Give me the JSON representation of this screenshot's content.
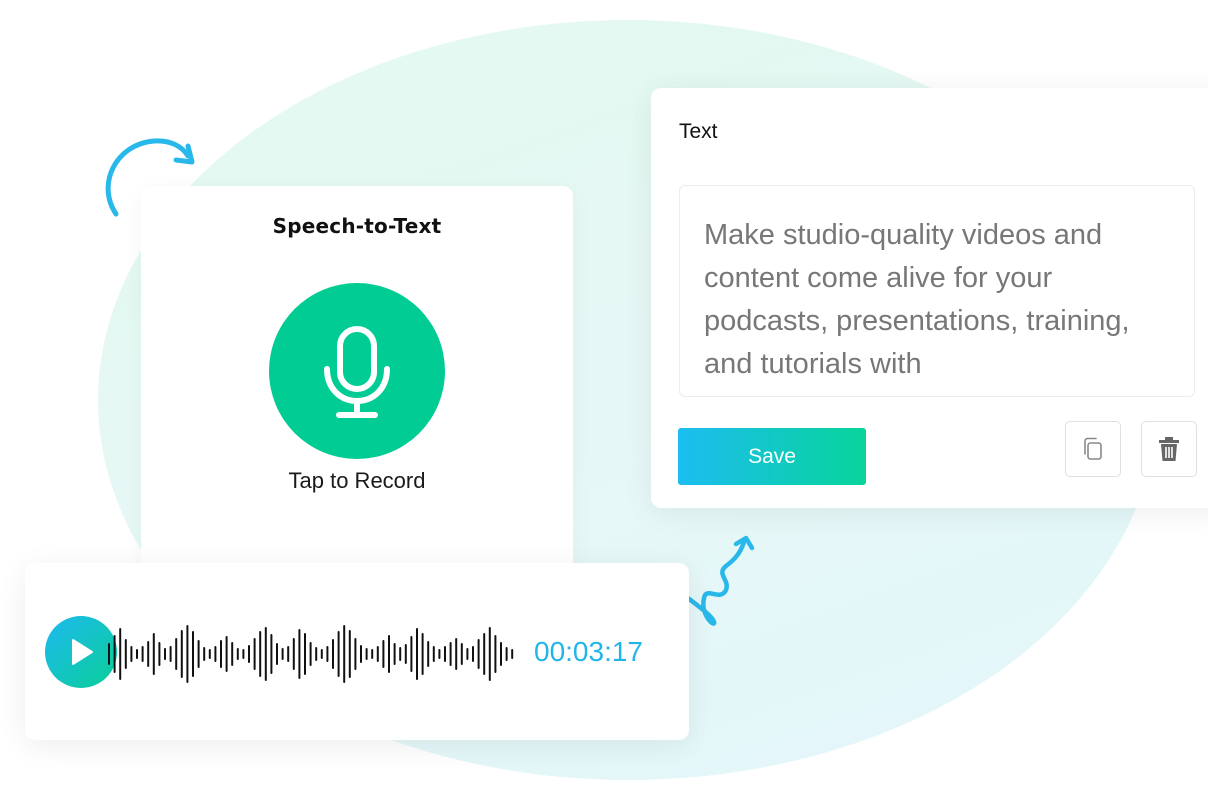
{
  "speech_card": {
    "title": "Speech-to-Text",
    "tap_label": "Tap to Record"
  },
  "text_panel": {
    "heading": "Text",
    "content": "Make studio-quality videos and content come alive for your podcasts, presentations, training, and tutorials with",
    "save_label": "Save"
  },
  "audio_player": {
    "time": "00:03:17"
  },
  "icons": {
    "mic": "microphone-icon",
    "play": "play-icon",
    "copy": "copy-icon",
    "trash": "trash-icon",
    "arrow_curved": "curved-arrow-icon",
    "arrow_squiggle": "squiggle-arrow-icon"
  },
  "colors": {
    "accent_green": "#00cc93",
    "accent_blue": "#22b5ea",
    "arrow": "#29b8ea"
  }
}
